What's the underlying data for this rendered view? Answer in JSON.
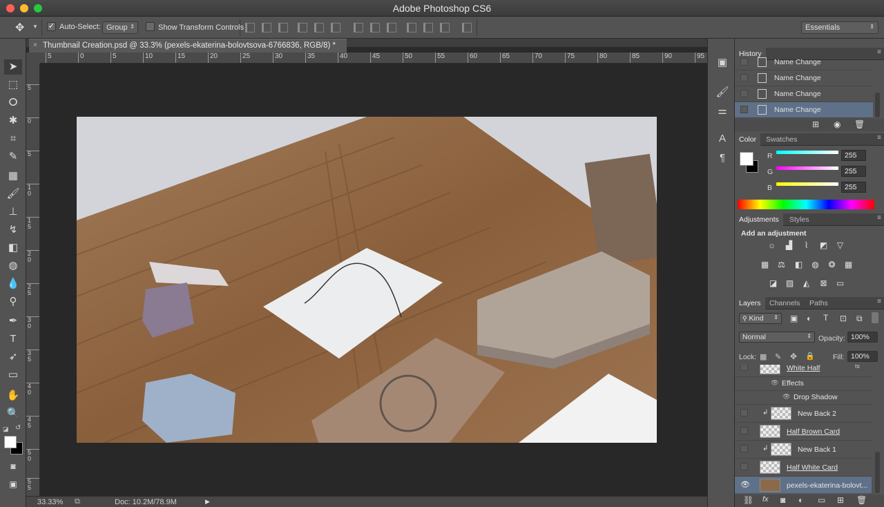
{
  "app": {
    "title": "Adobe Photoshop CS6"
  },
  "options": {
    "move_tool_icon": "move-icon",
    "auto_select_label": "Auto-Select:",
    "auto_select_value": "Group",
    "show_transform_label": "Show Transform Controls",
    "workspace": "Essentials"
  },
  "document": {
    "tab_title": "Thumbnail Creation.psd @ 33.3% (pexels-ekaterina-bolovtsova-6766836, RGB/8) *",
    "close_label": "×"
  },
  "ruler_h": [
    "5",
    "0",
    "5",
    "10",
    "15",
    "20",
    "25",
    "30",
    "35",
    "40",
    "45",
    "50",
    "55",
    "60",
    "65",
    "70",
    "75",
    "80",
    "85",
    "90",
    "95"
  ],
  "ruler_v": [
    "5",
    "0",
    "5",
    "1\n0",
    "1\n5",
    "2\n0",
    "2\n5",
    "3\n0",
    "3\n5",
    "4\n0",
    "4\n5",
    "5\n0",
    "5\n5"
  ],
  "status": {
    "zoom": "33.33%",
    "doc": "Doc: 10.2M/78.9M"
  },
  "history": {
    "tab": "History",
    "items": [
      "Name Change",
      "Name Change",
      "Name Change",
      "Name Change"
    ]
  },
  "color": {
    "tabs": [
      "Color",
      "Swatches"
    ],
    "channels": [
      {
        "label": "R",
        "value": "255"
      },
      {
        "label": "G",
        "value": "255"
      },
      {
        "label": "B",
        "value": "255"
      }
    ]
  },
  "adjustments": {
    "tabs": [
      "Adjustments",
      "Styles"
    ],
    "heading": "Add an adjustment"
  },
  "layers": {
    "tabs": [
      "Layers",
      "Channels",
      "Paths"
    ],
    "kind": "Kind",
    "blend_mode": "Normal",
    "opacity_label": "Opacity:",
    "opacity": "100%",
    "lock_label": "Lock:",
    "fill_label": "Fill:",
    "fill": "100%",
    "items": [
      {
        "name": "White Half",
        "type": "layer"
      },
      {
        "name": "Effects",
        "type": "effect"
      },
      {
        "name": "Drop Shadow",
        "type": "effect-sub"
      },
      {
        "name": "New Back 2",
        "type": "layer"
      },
      {
        "name": "Half Brown Card",
        "type": "layer"
      },
      {
        "name": "New Back 1",
        "type": "layer"
      },
      {
        "name": "Half White Card",
        "type": "layer"
      },
      {
        "name": "pexels-ekaterina-bolovt...",
        "type": "layer"
      }
    ]
  },
  "colors": {
    "accent_selected": "#5f7189",
    "panel": "#535353",
    "canvas": "#282828"
  }
}
